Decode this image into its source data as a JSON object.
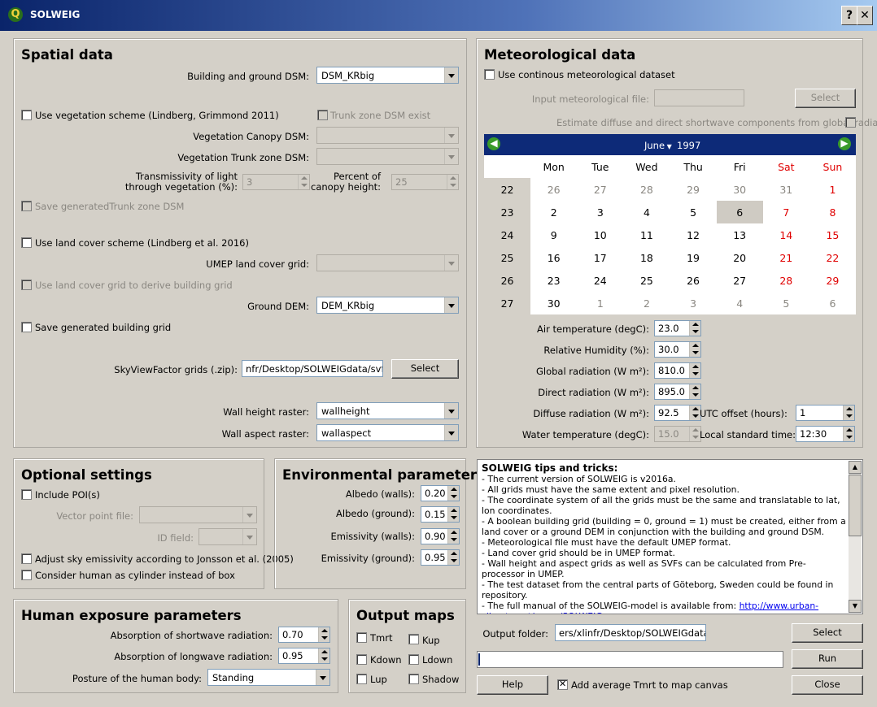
{
  "window": {
    "title": "SOLWEIG",
    "help_label": "?",
    "close_label": "✕"
  },
  "spatial": {
    "title": "Spatial data",
    "building_dsm_label": "Building and ground DSM:",
    "building_dsm_value": "DSM_KRbig",
    "use_veg_label": "Use vegetation scheme (Lindberg, Grimmond 2011)",
    "trunk_exist_label": "Trunk zone DSM exist",
    "veg_canopy_label": "Vegetation Canopy DSM:",
    "veg_trunk_label": "Vegetation Trunk zone DSM:",
    "transmissivity_label_1": "Transmissivity of light",
    "transmissivity_label_2": "through vegetation (%):",
    "transmissivity_value": "3",
    "percent_canopy_label_1": "Percent of",
    "percent_canopy_label_2": "canopy height:",
    "percent_canopy_value": "25",
    "save_trunk_label": "Save generatedTrunk zone DSM",
    "use_landcover_label": "Use land cover scheme (Lindberg et al. 2016)",
    "umep_landcover_label": "UMEP land cover grid:",
    "use_lc_building_label": "Use land cover grid to derive building grid",
    "ground_dem_label": "Ground DEM:",
    "ground_dem_value": "DEM_KRbig",
    "save_building_label": "Save generated building grid",
    "svf_label": "SkyViewFactor grids (.zip):",
    "svf_value": "nfr/Desktop/SOLWEIGdata/svfs.zip",
    "svf_select": "Select",
    "wall_height_label": "Wall height raster:",
    "wall_height_value": "wallheight",
    "wall_aspect_label": "Wall aspect raster:",
    "wall_aspect_value": "wallaspect"
  },
  "met": {
    "title": "Meteorological data",
    "use_continuous_label": "Use continous meteorological dataset",
    "input_file_label": "Input meteorological file:",
    "input_file_value": "",
    "select_label": "Select",
    "estimate_label": "Estimate diffuse and direct shortwave components from global radiation:",
    "calendar": {
      "month": "June",
      "year": "1997",
      "weekdays": [
        "Mon",
        "Tue",
        "Wed",
        "Thu",
        "Fri",
        "Sat",
        "Sun"
      ],
      "rows": [
        {
          "week": "22",
          "days": [
            "26",
            "27",
            "28",
            "29",
            "30",
            "31",
            "1"
          ]
        },
        {
          "week": "23",
          "days": [
            "2",
            "3",
            "4",
            "5",
            "6",
            "7",
            "8"
          ]
        },
        {
          "week": "24",
          "days": [
            "9",
            "10",
            "11",
            "12",
            "13",
            "14",
            "15"
          ]
        },
        {
          "week": "25",
          "days": [
            "16",
            "17",
            "18",
            "19",
            "20",
            "21",
            "22"
          ]
        },
        {
          "week": "26",
          "days": [
            "23",
            "24",
            "25",
            "26",
            "27",
            "28",
            "29"
          ]
        },
        {
          "week": "27",
          "days": [
            "30",
            "1",
            "2",
            "3",
            "4",
            "5",
            "6"
          ]
        }
      ]
    },
    "air_temp_label": "Air temperature (degC):",
    "air_temp_value": "23.0",
    "rh_label": "Relative Humidity (%):",
    "rh_value": "30.0",
    "global_rad_label": "Global radiation (W m²):",
    "global_rad_value": "810.0",
    "direct_rad_label": "Direct radiation (W m²):",
    "direct_rad_value": "895.0",
    "diffuse_rad_label": "Diffuse radiation (W m²):",
    "diffuse_rad_value": "92.5",
    "water_temp_label": "Water temperature (degC):",
    "water_temp_value": "15.0",
    "utc_label": "UTC offset (hours):",
    "utc_value": "1",
    "lst_label": "Local standard time:",
    "lst_value": "12:30"
  },
  "optional": {
    "title": "Optional settings",
    "include_poi_label": "Include POI(s)",
    "vector_point_label": "Vector point file:",
    "id_field_label": "ID field:",
    "adjust_sky_label": "Adjust sky emissivity according to Jonsson et al. (2005)",
    "cylinder_label": "Consider human as cylinder instead of box"
  },
  "env": {
    "title": "Environmental parameters",
    "albedo_walls_label": "Albedo (walls):",
    "albedo_walls_value": "0.20",
    "albedo_ground_label": "Albedo (ground):",
    "albedo_ground_value": "0.15",
    "emis_walls_label": "Emissivity (walls):",
    "emis_walls_value": "0.90",
    "emis_ground_label": "Emissivity (ground):",
    "emis_ground_value": "0.95"
  },
  "human": {
    "title": "Human exposure parameters",
    "abs_sw_label": "Absorption of shortwave radiation:",
    "abs_sw_value": "0.70",
    "abs_lw_label": "Absorption of longwave radiation:",
    "abs_lw_value": "0.95",
    "posture_label": "Posture of the human body:",
    "posture_value": "Standing"
  },
  "output_maps": {
    "title": "Output maps",
    "tmrt": "Tmrt",
    "kup": "Kup",
    "kdown": "Kdown",
    "ldown": "Ldown",
    "lup": "Lup",
    "shadow": "Shadow"
  },
  "tips": {
    "heading": "SOLWEIG tips and tricks:",
    "lines": [
      "- The current version of SOLWEIG is v2016a.",
      "- All grids must have the same extent and pixel resolution.",
      "- The coordinate system of all the grids must be the same and translatable to lat, lon coordinates.",
      "- A boolean building grid (building = 0, ground = 1) must be created, either from a land cover or a ground DEM in conjunction with the building and ground DSM.",
      "- Meteorological file must have the default UMEP format.",
      "- Land cover grid should be in UMEP format.",
      "- Wall height and aspect grids as well as SVFs can be calculated from Pre-processor in UMEP.",
      "- The test dataset from the central parts of Göteborg, Sweden could be found in repository.",
      "- The full manual of the SOLWEIG-model is available from: "
    ],
    "link": "http://www.urban-climate.net/umep/SOLWEIG"
  },
  "bottom": {
    "output_folder_label": "Output folder:",
    "output_folder_value": "ers/xlinfr/Desktop/SOLWEIGdata/out",
    "select_label": "Select",
    "run_label": "Run",
    "help_label": "Help",
    "add_tmrt_label": "Add average Tmrt to map canvas",
    "close_label": "Close"
  }
}
